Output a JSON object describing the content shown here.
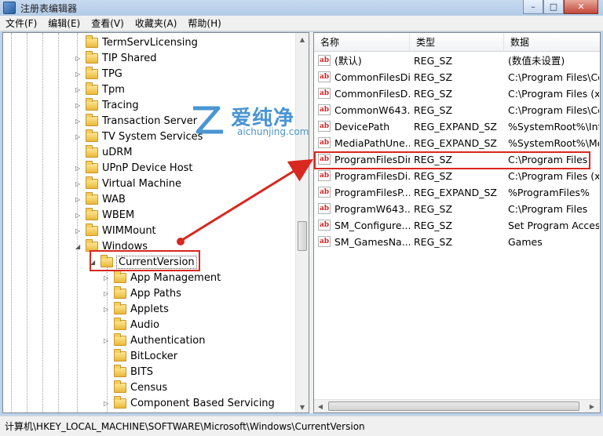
{
  "window": {
    "title": "注册表编辑器",
    "minimize": "–",
    "maximize": "□",
    "close": "✕"
  },
  "menu": [
    "文件(F)",
    "编辑(E)",
    "查看(V)",
    "收藏夹(A)",
    "帮助(H)"
  ],
  "tree": {
    "items": [
      {
        "label": "TermServLicensing",
        "expander": ""
      },
      {
        "label": "TIP Shared",
        "expander": "▷"
      },
      {
        "label": "TPG",
        "expander": "▷"
      },
      {
        "label": "Tpm",
        "expander": "▷"
      },
      {
        "label": "Tracing",
        "expander": "▷"
      },
      {
        "label": "Transaction Server",
        "expander": "▷"
      },
      {
        "label": "TV System Services",
        "expander": "▷"
      },
      {
        "label": "uDRM",
        "expander": ""
      },
      {
        "label": "UPnP Device Host",
        "expander": "▷"
      },
      {
        "label": "Virtual Machine",
        "expander": "▷"
      },
      {
        "label": "WAB",
        "expander": "▷"
      },
      {
        "label": "WBEM",
        "expander": "▷"
      },
      {
        "label": "WIMMount",
        "expander": "▷"
      },
      {
        "label": "Windows",
        "expander": "◢"
      }
    ],
    "selected": {
      "label": "CurrentVersion",
      "expander": "◢"
    },
    "children": [
      {
        "label": "App Management",
        "expander": "▷"
      },
      {
        "label": "App Paths",
        "expander": "▷"
      },
      {
        "label": "Applets",
        "expander": "▷"
      },
      {
        "label": "Audio",
        "expander": ""
      },
      {
        "label": "Authentication",
        "expander": "▷"
      },
      {
        "label": "BitLocker",
        "expander": ""
      },
      {
        "label": "BITS",
        "expander": ""
      },
      {
        "label": "Census",
        "expander": ""
      },
      {
        "label": "Component Based Servicing",
        "expander": "▷"
      }
    ]
  },
  "list": {
    "columns": [
      "名称",
      "类型",
      "数据"
    ],
    "rows": [
      {
        "name": "(默认)",
        "type": "REG_SZ",
        "data": "(数值未设置)"
      },
      {
        "name": "CommonFilesDir",
        "type": "REG_SZ",
        "data": "C:\\Program Files\\Co"
      },
      {
        "name": "CommonFilesD...",
        "type": "REG_SZ",
        "data": "C:\\Program Files (x8"
      },
      {
        "name": "CommonW643...",
        "type": "REG_SZ",
        "data": "C:\\Program Files\\Co"
      },
      {
        "name": "DevicePath",
        "type": "REG_EXPAND_SZ",
        "data": "%SystemRoot%\\Inf"
      },
      {
        "name": "MediaPathUne...",
        "type": "REG_EXPAND_SZ",
        "data": "%SystemRoot%\\Me"
      },
      {
        "name": "ProgramFilesDir",
        "type": "REG_SZ",
        "data": "C:\\Program Files"
      },
      {
        "name": "ProgramFilesDi...",
        "type": "REG_SZ",
        "data": "C:\\Program Files (x8"
      },
      {
        "name": "ProgramFilesP...",
        "type": "REG_EXPAND_SZ",
        "data": "%ProgramFiles%"
      },
      {
        "name": "ProgramW643...",
        "type": "REG_SZ",
        "data": "C:\\Program Files"
      },
      {
        "name": "SM_Configure...",
        "type": "REG_SZ",
        "data": "Set Program Access"
      },
      {
        "name": "SM_GamesNa...",
        "type": "REG_SZ",
        "data": "Games"
      }
    ],
    "value_icon": "ab"
  },
  "status": {
    "path": "计算机\\HKEY_LOCAL_MACHINE\\SOFTWARE\\Microsoft\\Windows\\CurrentVersion"
  },
  "watermark": {
    "cn": "爱纯净",
    "en": "aichunjing.com"
  },
  "scroll": {
    "up": "▲",
    "down": "▼",
    "left": "◀",
    "right": "▶"
  },
  "colors": {
    "annotation_red": "#d8281f",
    "watermark_blue": "#4a95d2"
  }
}
